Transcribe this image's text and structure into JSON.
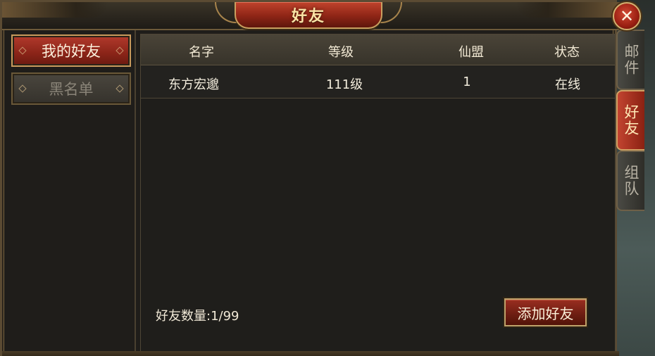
{
  "window": {
    "title": "好友"
  },
  "categories": [
    {
      "label": "我的好友",
      "active": true
    },
    {
      "label": "黑名单",
      "active": false
    }
  ],
  "table": {
    "columns": [
      "名字",
      "等级",
      "仙盟",
      "状态"
    ],
    "rows": [
      {
        "name": "东方宏邈",
        "level": "111级",
        "guild": "1",
        "status": "在线"
      }
    ]
  },
  "footer": {
    "friend_count": "好友数量:1/99",
    "add_label": "添加好友"
  },
  "side_tabs": [
    {
      "label": "邮件",
      "active": false
    },
    {
      "label": "好友",
      "active": true
    },
    {
      "label": "组队",
      "active": false
    }
  ],
  "colors": {
    "accent_red": "#9a2e20",
    "gold_border": "#c9a060",
    "panel_bg": "#1f1d1a"
  },
  "icons": {
    "close": "close-icon"
  }
}
